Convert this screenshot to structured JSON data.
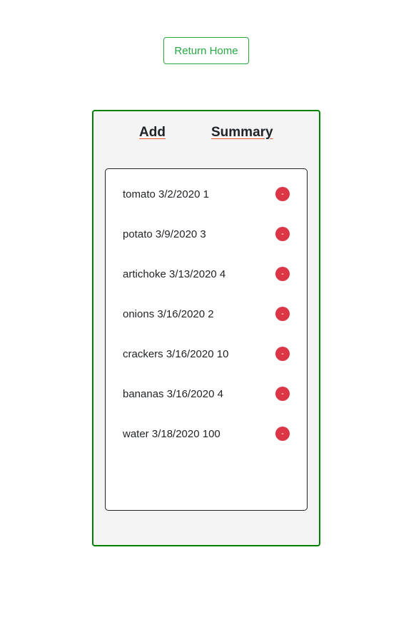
{
  "header": {
    "return_home_label": "Return Home"
  },
  "nav": {
    "add_label": "Add",
    "summary_label": "Summary"
  },
  "items": [
    {
      "text": "tomato 3/2/2020 1",
      "remove_label": "-"
    },
    {
      "text": "potato 3/9/2020 3",
      "remove_label": "-"
    },
    {
      "text": "artichoke 3/13/2020 4",
      "remove_label": "-"
    },
    {
      "text": "onions 3/16/2020 2",
      "remove_label": "-"
    },
    {
      "text": "crackers 3/16/2020 10",
      "remove_label": "-"
    },
    {
      "text": "bananas 3/16/2020 4",
      "remove_label": "-"
    },
    {
      "text": "water 3/18/2020 100",
      "remove_label": "-"
    }
  ],
  "colors": {
    "accent_green": "#28a745",
    "panel_border": "#008000",
    "remove_red": "#dc3545",
    "underline": "#e8552d"
  }
}
